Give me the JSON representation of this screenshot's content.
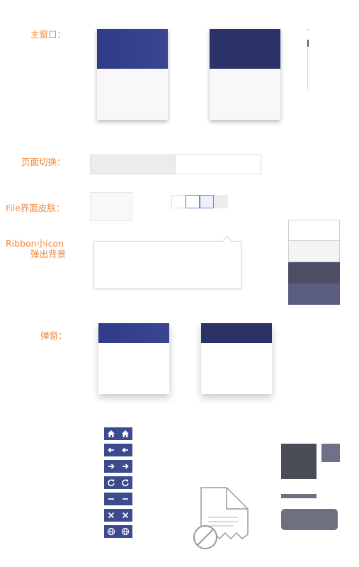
{
  "labels": {
    "main_window": "主窗口：",
    "page_switch": "页面切换：",
    "file_skin": "File界面皮肤：",
    "ribbon_icon_line1": "Ribbon小icon",
    "ribbon_icon_line2": "弹出背景",
    "popup": "弹窗："
  },
  "colors": {
    "label": "#f0883a",
    "title_blue": "#3a4590",
    "title_dark": "#2a3268",
    "icon_button": "#3c4a8e",
    "swatch_white": "#ffffff",
    "swatch_light": "#f4f4f4",
    "swatch_dark": "#4d4e66",
    "swatch_mid": "#5b5e80",
    "tile_dark": "#4a4c56",
    "tile_small": "#6e7188",
    "pill": "#6e7080"
  },
  "icon_buttons": [
    {
      "name": "home-icon"
    },
    {
      "name": "arrow-left-icon"
    },
    {
      "name": "arrow-right-icon"
    },
    {
      "name": "refresh-icon"
    },
    {
      "name": "minus-icon"
    },
    {
      "name": "close-icon"
    },
    {
      "name": "globe-icon"
    }
  ]
}
